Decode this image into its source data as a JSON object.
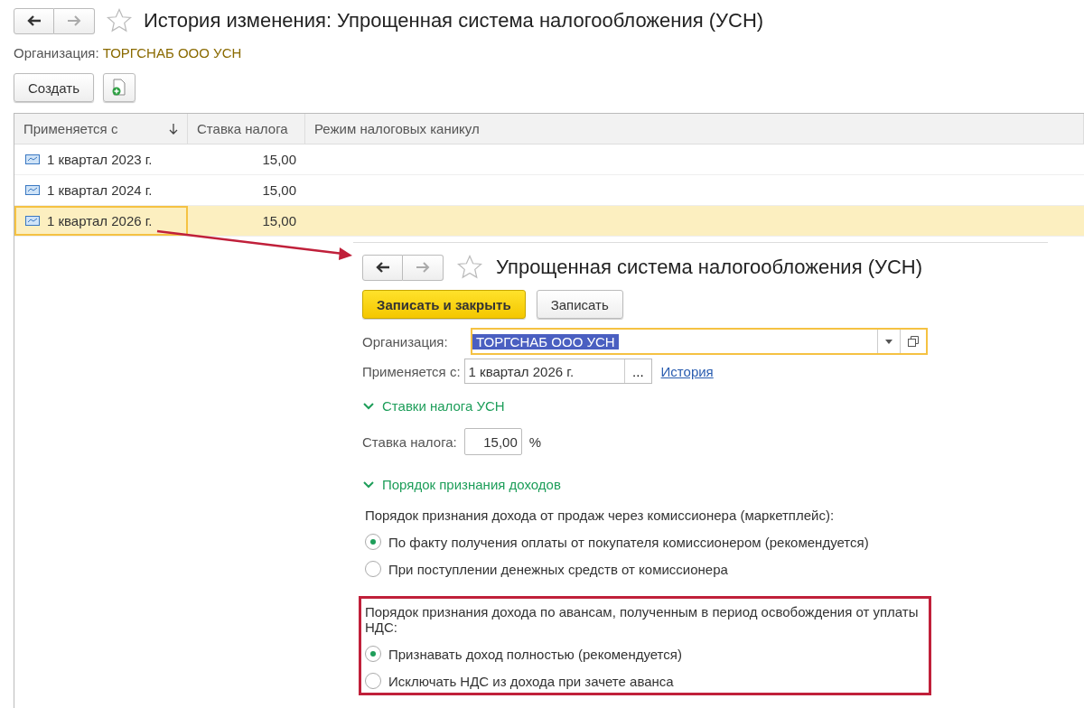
{
  "window": {
    "title": "История изменения: Упрощенная система налогообложения (УСН)"
  },
  "organization": {
    "label": "Организация:",
    "value": "ТОРГСНАБ ООО УСН"
  },
  "toolbar": {
    "create_button": "Создать"
  },
  "table": {
    "columns": [
      {
        "label": "Применяется с",
        "sorted": true
      },
      {
        "label": "Ставка налога",
        "sorted": false
      },
      {
        "label": "Режим налоговых каникул",
        "sorted": false
      }
    ],
    "rows": [
      {
        "period": "1 квартал 2023 г.",
        "rate": "15,00",
        "selected": false
      },
      {
        "period": "1 квартал 2024 г.",
        "rate": "15,00",
        "selected": false
      },
      {
        "period": "1 квартал 2026 г.",
        "rate": "15,00",
        "selected": true
      }
    ]
  },
  "form": {
    "title": "Упрощенная система налогообложения (УСН)",
    "buttons": [
      {
        "label": "Записать и закрыть",
        "kind": "primary"
      },
      {
        "label": "Записать",
        "kind": "default"
      }
    ],
    "organization": {
      "label": "Организация:",
      "value": "ТОРГСНАБ ООО УСН",
      "text_selected": true
    },
    "applies_from": {
      "label": "Применяется с:",
      "value": "1 квартал 2026 г.",
      "select_button": "...",
      "history_link": "История"
    },
    "rate_section": {
      "title": "Ставки налога УСН",
      "expanded": true,
      "rate_label": "Ставка налога:",
      "rate_value": "15,00",
      "unit": "%"
    },
    "income_section": {
      "title": "Порядок признания доходов",
      "expanded": true,
      "groups": [
        {
          "question": "Порядок признания дохода от продаж через комиссионера (маркетплейс):",
          "highlighted": false,
          "options": [
            {
              "label": "По факту получения оплаты от покупателя комиссионером (рекомендуется)",
              "selected": true
            },
            {
              "label": "При поступлении денежных средств от комиссионера",
              "selected": false
            }
          ]
        },
        {
          "question": "Порядок признания дохода по авансам, полученным в период освобождения от уплаты НДС:",
          "highlighted": true,
          "options": [
            {
              "label": "Признавать доход полностью (рекомендуется)",
              "selected": true
            },
            {
              "label": "Исключать НДС из дохода при зачете аванса",
              "selected": false
            }
          ]
        }
      ]
    }
  }
}
